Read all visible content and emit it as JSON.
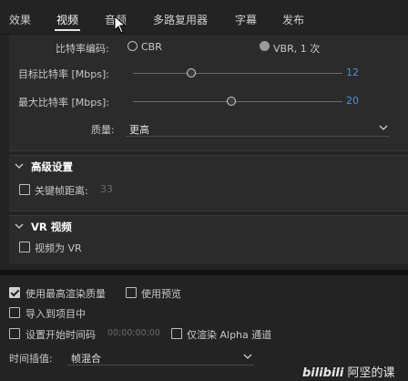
{
  "tabs": [
    {
      "label": "效果",
      "active": false
    },
    {
      "label": "视频",
      "active": true
    },
    {
      "label": "音频",
      "active": false
    },
    {
      "label": "多路复用器",
      "active": false
    },
    {
      "label": "字幕",
      "active": false
    },
    {
      "label": "发布",
      "active": false
    }
  ],
  "bitrate": {
    "encoding_label": "比特率编码:",
    "cbr_label": "CBR",
    "vbr_label": "VBR, 1 次",
    "selected": "VBR, 1 次",
    "target_label": "目标比特率 [Mbps]:",
    "target_value": "12",
    "target_level": 0.28,
    "max_label": "最大比特率 [Mbps]:",
    "max_value": "20",
    "max_level": 0.47,
    "quality_label": "质量:",
    "quality_value": "更高"
  },
  "advanced": {
    "title": "高级设置",
    "keyframe_label": "关键帧距离:",
    "keyframe_value": "33",
    "keyframe_checked": false
  },
  "vr": {
    "title": "VR 视频",
    "video_is_vr_label": "视频为 VR",
    "checked": false
  },
  "options": {
    "max_quality_label": "使用最高渲染质量",
    "max_quality_checked": true,
    "use_preview_label": "使用预览",
    "use_preview_checked": false,
    "import_label": "导入到项目中",
    "import_checked": false,
    "start_tc_label": "设置开始时间码",
    "start_tc_value": "00;00;00;00",
    "start_tc_checked": false,
    "alpha_label": "仅渲染 Alpha 通道",
    "alpha_checked": false,
    "interp_label": "时间插值:",
    "interp_value": "帧混合"
  },
  "watermark": {
    "brand": "bilibili",
    "text": "阿坚的课"
  },
  "colors": {
    "accent_blue": "#4a8fe7",
    "background": "#232323",
    "panel": "#2b2b2b"
  }
}
